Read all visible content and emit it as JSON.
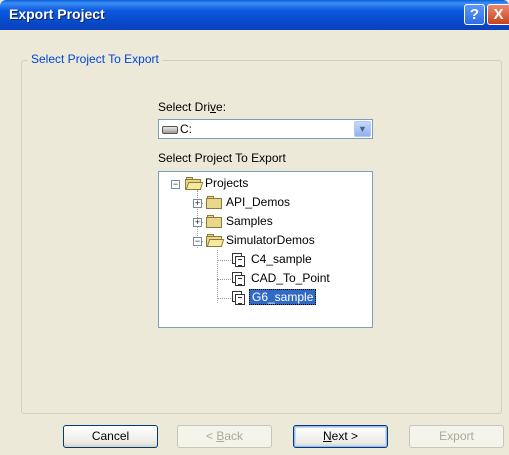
{
  "window": {
    "title": "Export Project",
    "help_glyph": "?",
    "close_glyph": "X"
  },
  "group": {
    "label": "Select Project To Export"
  },
  "drive": {
    "label_pre": "Select Dri",
    "label_mnemonic": "v",
    "label_post": "e:",
    "value": "C:",
    "icon": "hard-drive-icon",
    "arrow_glyph": "▼"
  },
  "project_list": {
    "label": "Select Project To Export"
  },
  "tree": {
    "root": {
      "label": "Projects",
      "expander": "−"
    },
    "children": [
      {
        "label": "API_Demos",
        "expander": "+"
      },
      {
        "label": "Samples",
        "expander": "+"
      },
      {
        "label": "SimulatorDemos",
        "expander": "−"
      }
    ],
    "leaves": [
      {
        "label": "C4_sample"
      },
      {
        "label": "CAD_To_Point"
      },
      {
        "label": "G6_sample",
        "selected": true
      }
    ]
  },
  "buttons": {
    "cancel": "Cancel",
    "back_pre": "< ",
    "back_mnemonic": "B",
    "back_post": "ack",
    "next_mnemonic": "N",
    "next_post": "ext >",
    "export": "Export"
  }
}
